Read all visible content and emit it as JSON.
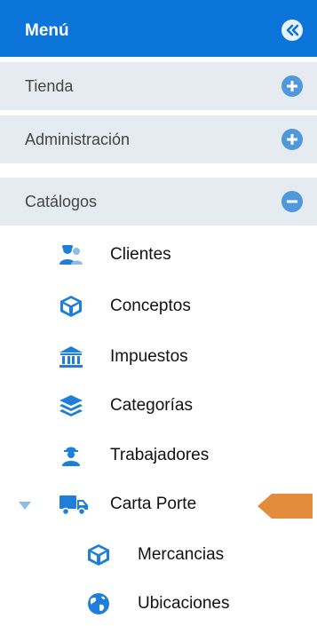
{
  "header": {
    "title": "Menú"
  },
  "sections": [
    {
      "label": "Tienda",
      "state": "collapsed"
    },
    {
      "label": "Administración",
      "state": "collapsed"
    },
    {
      "label": "Catálogos",
      "state": "expanded"
    }
  ],
  "catalog_items": [
    {
      "label": "Clientes",
      "icon": "users-icon"
    },
    {
      "label": "Conceptos",
      "icon": "box-icon"
    },
    {
      "label": "Impuestos",
      "icon": "bank-icon"
    },
    {
      "label": "Categorías",
      "icon": "layers-icon"
    },
    {
      "label": "Trabajadores",
      "icon": "worker-icon"
    },
    {
      "label": "Carta Porte",
      "icon": "truck-icon",
      "expanded": true
    }
  ],
  "carta_porte_items": [
    {
      "label": "Mercancias",
      "icon": "box-icon"
    },
    {
      "label": "Ubicaciones",
      "icon": "globe-icon"
    }
  ],
  "colors": {
    "accent": "#0a74d9",
    "section_bg": "#e5ebf1",
    "icon_blue": "#1f7fd8",
    "pointer_orange": "#e58b3c"
  }
}
